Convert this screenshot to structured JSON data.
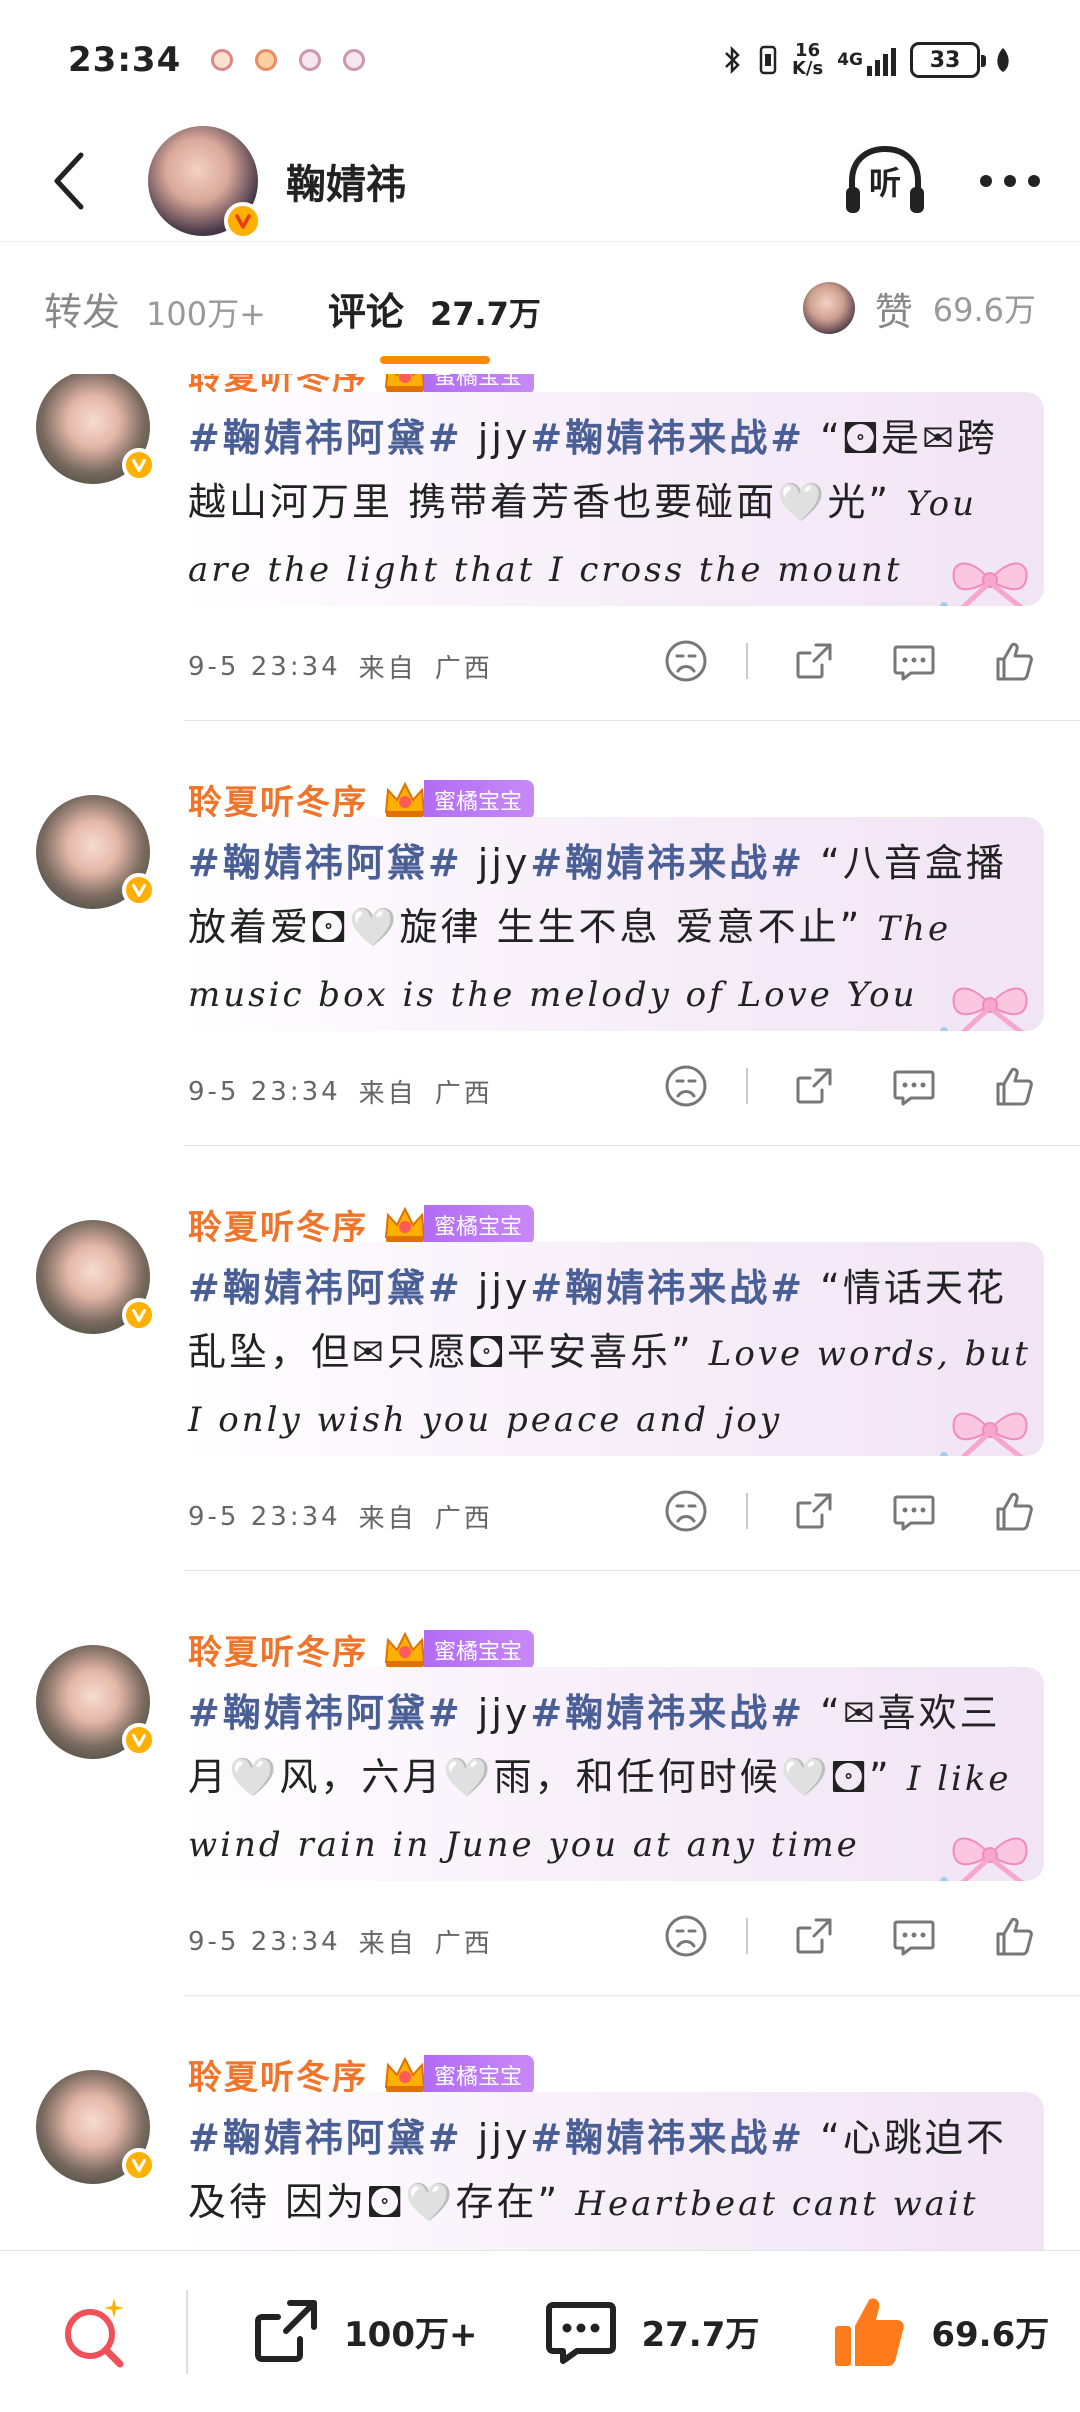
{
  "status_bar": {
    "time": "23:34",
    "net_speed_value": "16",
    "net_speed_unit": "K/s",
    "network": "4G",
    "battery": "33"
  },
  "header": {
    "name": "鞠婧祎",
    "listen_label": "听"
  },
  "tabs": {
    "repost_label": "转发",
    "repost_count": "100万+",
    "comment_label": "评论",
    "comment_count": "27.7万",
    "like_label": "赞",
    "like_count": "69.6万"
  },
  "colors": {
    "accent": "#ff8a00",
    "username": "#f0742a",
    "hashtag": "#4a5f96",
    "badge": "#b26cf4",
    "like_orange": "#ff7a1a",
    "search_red": "#f0505a"
  },
  "comments": [
    {
      "user": "聆夏听冬序",
      "badge": "蜜橘宝宝",
      "tag1": "#鞠婧祎阿黛#",
      "mid": " jjy",
      "tag2": "#鞠婧祎来战#",
      "text": " “🖸是✉跨越山河万里 携带着芳香也要碰面🤍光”",
      "english": "You are the light that I cross the mount",
      "time": "9-5 23:34",
      "from": "来自",
      "location": "广西"
    },
    {
      "user": "聆夏听冬序",
      "badge": "蜜橘宝宝",
      "tag1": "#鞠婧祎阿黛#",
      "mid": " jjy",
      "tag2": "#鞠婧祎来战#",
      "text": " “八音盒播放着爱🖸🤍旋律 生生不息 爱意不止”",
      "english": "The music box is the melody of Love You",
      "time": "9-5 23:34",
      "from": "来自",
      "location": "广西"
    },
    {
      "user": "聆夏听冬序",
      "badge": "蜜橘宝宝",
      "tag1": "#鞠婧祎阿黛#",
      "mid": " jjy",
      "tag2": "#鞠婧祎来战#",
      "text": " “情话天花乱坠，但✉只愿🖸平安喜乐”",
      "english": "Love words, but I only wish you peace and joy",
      "time": "9-5 23:34",
      "from": "来自",
      "location": "广西"
    },
    {
      "user": "聆夏听冬序",
      "badge": "蜜橘宝宝",
      "tag1": "#鞠婧祎阿黛#",
      "mid": " jjy",
      "tag2": "#鞠婧祎来战#",
      "text": " “✉喜欢三月🤍风，六月🤍雨，和任何时候🤍🖸”",
      "english": "I like wind rain in June you at any time",
      "time": "9-5 23:34",
      "from": "来自",
      "location": "广西"
    },
    {
      "user": "聆夏听冬序",
      "badge": "蜜橘宝宝",
      "tag1": "#鞠婧祎阿黛#",
      "mid": " jjy",
      "tag2": "#鞠婧祎来战#",
      "text": " “心跳迫不及待 因为🖸🤍存在”",
      "english": "Heartbeat cant wait",
      "time": "",
      "from": "",
      "location": ""
    }
  ],
  "bottom_bar": {
    "repost_count": "100万+",
    "comment_count": "27.7万",
    "like_count": "69.6万"
  }
}
